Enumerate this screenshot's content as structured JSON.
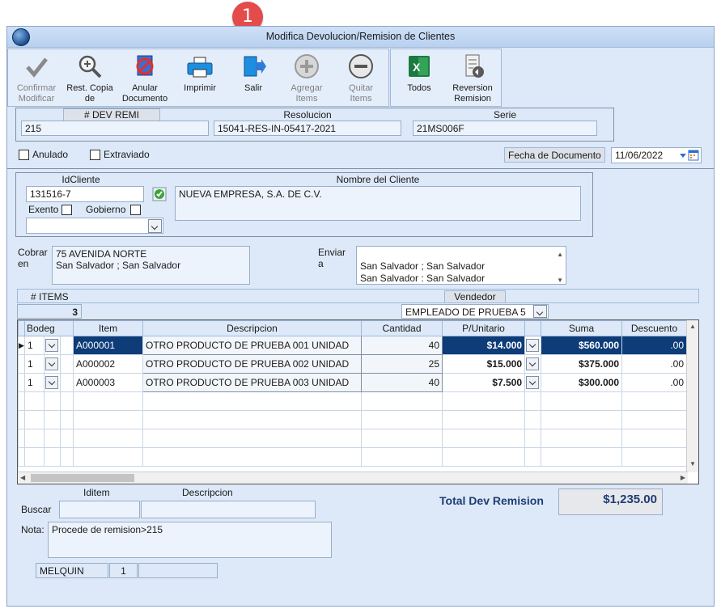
{
  "window": {
    "title": "Modifica Devolucion/Remision de Clientes"
  },
  "badge": {
    "number": "1"
  },
  "toolbar": {
    "confirmar": "Confirmar Modificar",
    "confirmar_l1": "Confirmar",
    "confirmar_l2": "Modificar",
    "rest_l1": "Rest. Copia",
    "rest_l2": "de",
    "anular_l1": "Anular",
    "anular_l2": "Documento",
    "imprimir": "Imprimir",
    "salir": "Salir",
    "agregar_l1": "Agregar",
    "agregar_l2": "Items",
    "quitar_l1": "Quitar",
    "quitar_l2": "Items",
    "todos": "Todos",
    "reversion_l1": "Reversion",
    "reversion_l2": "Remision"
  },
  "doc": {
    "devremi_label": "# DEV REMI",
    "devremi_value": "215",
    "resolucion_label": "Resolucion",
    "resolucion_value": "15041-RES-IN-05417-2021",
    "serie_label": "Serie",
    "serie_value": "21MS006F",
    "anulado_label": "Anulado",
    "extraviado_label": "Extraviado",
    "fecha_label": "Fecha de  Documento",
    "fecha_value": "11/06/2022"
  },
  "cliente": {
    "id_label": "IdCliente",
    "id_value": "131516-7",
    "nombre_label": "Nombre del Cliente",
    "nombre_value": "NUEVA EMPRESA, S.A. DE C.V.",
    "exento_label": "Exento",
    "gobierno_label": "Gobierno"
  },
  "direcciones": {
    "cobrar_l1": "Cobrar",
    "cobrar_l2": "en",
    "cobrar_line1": "75 AVENIDA NORTE",
    "cobrar_line2": "San Salvador ; San Salvador",
    "enviar_l1": "Enviar",
    "enviar_l2": "a",
    "enviar_line1": "San Salvador ; San Salvador",
    "enviar_line2": "San Salvador : San Salvador"
  },
  "items_header": {
    "items_label": "# ITEMS",
    "items_count": "3",
    "vendedor_label": "Vendedor",
    "vendedor_value": "EMPLEADO DE PRUEBA 5"
  },
  "grid": {
    "columns": [
      "Bodega",
      "Item",
      "Descripcion",
      "Cantidad",
      "P/Unitario",
      "Suma",
      "Descuento"
    ],
    "col_bodega": "Bodeg",
    "rows": [
      {
        "bodega": "1",
        "item": "A000001",
        "desc": "OTRO PRODUCTO DE PRUEBA 001 UNIDAD",
        "cantidad": "40",
        "punit": "$14.000",
        "suma": "$560.000",
        "descuento": ".00"
      },
      {
        "bodega": "1",
        "item": "A000002",
        "desc": "OTRO PRODUCTO DE PRUEBA 002 UNIDAD",
        "cantidad": "25",
        "punit": "$15.000",
        "suma": "$375.000",
        "descuento": ".00"
      },
      {
        "bodega": "1",
        "item": "A000003",
        "desc": "OTRO PRODUCTO DE PRUEBA 003 UNIDAD",
        "cantidad": "40",
        "punit": "$7.500",
        "suma": "$300.000",
        "descuento": ".00"
      }
    ]
  },
  "footer": {
    "iditem_label": "Iditem",
    "descripcion_label": "Descripcion",
    "buscar_label": "Buscar",
    "nota_label": "Nota:",
    "nota_value": "Procede de remision>215",
    "total_label": "Total Dev Remision",
    "total_value": "$1,235.00",
    "user": "MELQUIN",
    "station": "1"
  },
  "colors": {
    "accent": "#0d3c78",
    "badge": "#e44b4b",
    "total": "#1f3c73"
  }
}
